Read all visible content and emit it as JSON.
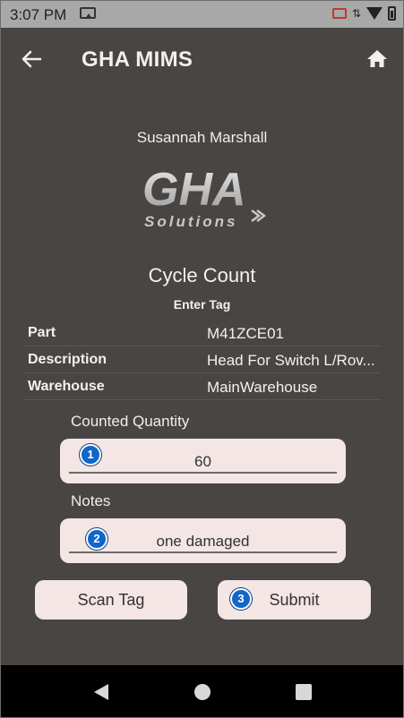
{
  "status_bar": {
    "time": "3:07 PM",
    "icons": [
      "cast-icon",
      "screen-cast-icon",
      "data-arrows-icon",
      "wifi-icon",
      "battery-icon"
    ]
  },
  "app_bar": {
    "title": "GHA MIMS",
    "back_icon": "arrow-left-icon",
    "home_icon": "home-icon"
  },
  "user": {
    "name": "Susannah Marshall"
  },
  "logo": {
    "brand": "GHA",
    "tagline": "Solutions"
  },
  "screen": {
    "title": "Cycle Count",
    "subtitle": "Enter Tag"
  },
  "details": [
    {
      "label": "Part",
      "value": "M41ZCE01"
    },
    {
      "label": "Description",
      "value": "Head For Switch L/Rov..."
    },
    {
      "label": "Warehouse",
      "value": "MainWarehouse"
    }
  ],
  "form": {
    "quantity_label": "Counted Quantity",
    "quantity_value": "60",
    "notes_label": "Notes",
    "notes_value": "one damaged"
  },
  "badges": {
    "one": "1",
    "two": "2",
    "three": "3"
  },
  "buttons": {
    "scan_tag": "Scan Tag",
    "submit": "Submit"
  },
  "colors": {
    "background": "#484543",
    "field_bg": "#f3e6e4",
    "badge": "#1166c8",
    "status_bar": "#a8a8a8"
  }
}
